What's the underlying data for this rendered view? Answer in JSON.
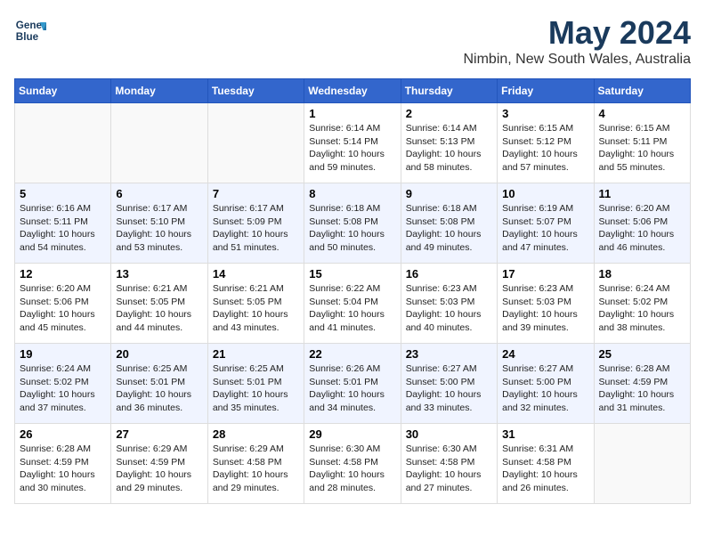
{
  "header": {
    "logo_line1": "General",
    "logo_line2": "Blue",
    "title": "May 2024",
    "subtitle": "Nimbin, New South Wales, Australia"
  },
  "days_of_week": [
    "Sunday",
    "Monday",
    "Tuesday",
    "Wednesday",
    "Thursday",
    "Friday",
    "Saturday"
  ],
  "weeks": [
    [
      {
        "day": "",
        "info": ""
      },
      {
        "day": "",
        "info": ""
      },
      {
        "day": "",
        "info": ""
      },
      {
        "day": "1",
        "info": "Sunrise: 6:14 AM\nSunset: 5:14 PM\nDaylight: 10 hours\nand 59 minutes."
      },
      {
        "day": "2",
        "info": "Sunrise: 6:14 AM\nSunset: 5:13 PM\nDaylight: 10 hours\nand 58 minutes."
      },
      {
        "day": "3",
        "info": "Sunrise: 6:15 AM\nSunset: 5:12 PM\nDaylight: 10 hours\nand 57 minutes."
      },
      {
        "day": "4",
        "info": "Sunrise: 6:15 AM\nSunset: 5:11 PM\nDaylight: 10 hours\nand 55 minutes."
      }
    ],
    [
      {
        "day": "5",
        "info": "Sunrise: 6:16 AM\nSunset: 5:11 PM\nDaylight: 10 hours\nand 54 minutes."
      },
      {
        "day": "6",
        "info": "Sunrise: 6:17 AM\nSunset: 5:10 PM\nDaylight: 10 hours\nand 53 minutes."
      },
      {
        "day": "7",
        "info": "Sunrise: 6:17 AM\nSunset: 5:09 PM\nDaylight: 10 hours\nand 51 minutes."
      },
      {
        "day": "8",
        "info": "Sunrise: 6:18 AM\nSunset: 5:08 PM\nDaylight: 10 hours\nand 50 minutes."
      },
      {
        "day": "9",
        "info": "Sunrise: 6:18 AM\nSunset: 5:08 PM\nDaylight: 10 hours\nand 49 minutes."
      },
      {
        "day": "10",
        "info": "Sunrise: 6:19 AM\nSunset: 5:07 PM\nDaylight: 10 hours\nand 47 minutes."
      },
      {
        "day": "11",
        "info": "Sunrise: 6:20 AM\nSunset: 5:06 PM\nDaylight: 10 hours\nand 46 minutes."
      }
    ],
    [
      {
        "day": "12",
        "info": "Sunrise: 6:20 AM\nSunset: 5:06 PM\nDaylight: 10 hours\nand 45 minutes."
      },
      {
        "day": "13",
        "info": "Sunrise: 6:21 AM\nSunset: 5:05 PM\nDaylight: 10 hours\nand 44 minutes."
      },
      {
        "day": "14",
        "info": "Sunrise: 6:21 AM\nSunset: 5:05 PM\nDaylight: 10 hours\nand 43 minutes."
      },
      {
        "day": "15",
        "info": "Sunrise: 6:22 AM\nSunset: 5:04 PM\nDaylight: 10 hours\nand 41 minutes."
      },
      {
        "day": "16",
        "info": "Sunrise: 6:23 AM\nSunset: 5:03 PM\nDaylight: 10 hours\nand 40 minutes."
      },
      {
        "day": "17",
        "info": "Sunrise: 6:23 AM\nSunset: 5:03 PM\nDaylight: 10 hours\nand 39 minutes."
      },
      {
        "day": "18",
        "info": "Sunrise: 6:24 AM\nSunset: 5:02 PM\nDaylight: 10 hours\nand 38 minutes."
      }
    ],
    [
      {
        "day": "19",
        "info": "Sunrise: 6:24 AM\nSunset: 5:02 PM\nDaylight: 10 hours\nand 37 minutes."
      },
      {
        "day": "20",
        "info": "Sunrise: 6:25 AM\nSunset: 5:01 PM\nDaylight: 10 hours\nand 36 minutes."
      },
      {
        "day": "21",
        "info": "Sunrise: 6:25 AM\nSunset: 5:01 PM\nDaylight: 10 hours\nand 35 minutes."
      },
      {
        "day": "22",
        "info": "Sunrise: 6:26 AM\nSunset: 5:01 PM\nDaylight: 10 hours\nand 34 minutes."
      },
      {
        "day": "23",
        "info": "Sunrise: 6:27 AM\nSunset: 5:00 PM\nDaylight: 10 hours\nand 33 minutes."
      },
      {
        "day": "24",
        "info": "Sunrise: 6:27 AM\nSunset: 5:00 PM\nDaylight: 10 hours\nand 32 minutes."
      },
      {
        "day": "25",
        "info": "Sunrise: 6:28 AM\nSunset: 4:59 PM\nDaylight: 10 hours\nand 31 minutes."
      }
    ],
    [
      {
        "day": "26",
        "info": "Sunrise: 6:28 AM\nSunset: 4:59 PM\nDaylight: 10 hours\nand 30 minutes."
      },
      {
        "day": "27",
        "info": "Sunrise: 6:29 AM\nSunset: 4:59 PM\nDaylight: 10 hours\nand 29 minutes."
      },
      {
        "day": "28",
        "info": "Sunrise: 6:29 AM\nSunset: 4:58 PM\nDaylight: 10 hours\nand 29 minutes."
      },
      {
        "day": "29",
        "info": "Sunrise: 6:30 AM\nSunset: 4:58 PM\nDaylight: 10 hours\nand 28 minutes."
      },
      {
        "day": "30",
        "info": "Sunrise: 6:30 AM\nSunset: 4:58 PM\nDaylight: 10 hours\nand 27 minutes."
      },
      {
        "day": "31",
        "info": "Sunrise: 6:31 AM\nSunset: 4:58 PM\nDaylight: 10 hours\nand 26 minutes."
      },
      {
        "day": "",
        "info": ""
      }
    ]
  ]
}
